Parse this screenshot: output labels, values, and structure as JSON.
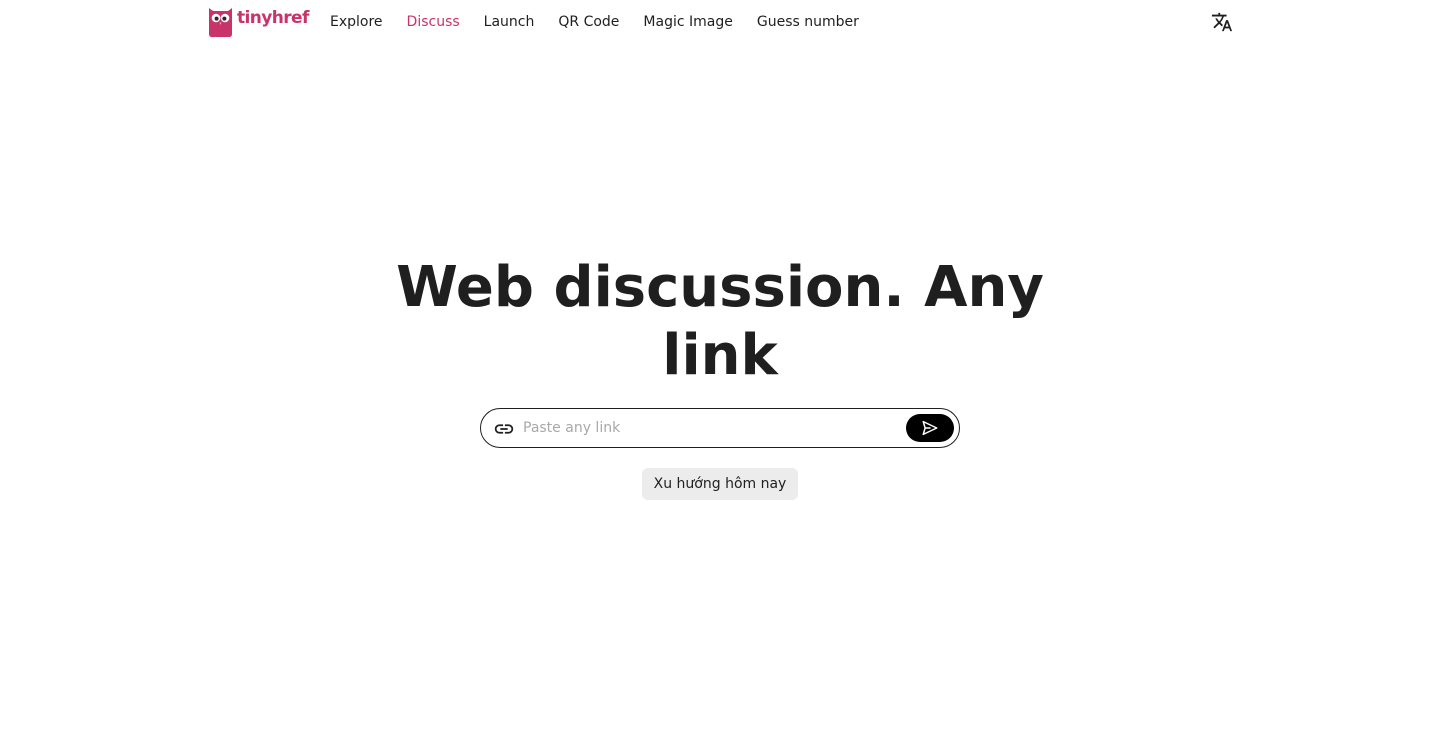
{
  "brand": {
    "name": "tinyhref",
    "color": "#c8336a",
    "icon": "owl-logo-icon"
  },
  "nav": {
    "items": [
      {
        "label": "Explore",
        "active": false
      },
      {
        "label": "Discuss",
        "active": true
      },
      {
        "label": "Launch",
        "active": false
      },
      {
        "label": "QR Code",
        "active": false
      },
      {
        "label": "Magic Image",
        "active": false
      },
      {
        "label": "Guess number",
        "active": false
      }
    ]
  },
  "language_button": {
    "icon": "translate-icon"
  },
  "hero": {
    "title": "Web discussion. Any link"
  },
  "search": {
    "placeholder": "Paste any link",
    "value": "",
    "leading_icon": "link-icon",
    "submit_icon": "send-icon"
  },
  "trending_button": {
    "label": "Xu hướng hôm nay"
  }
}
